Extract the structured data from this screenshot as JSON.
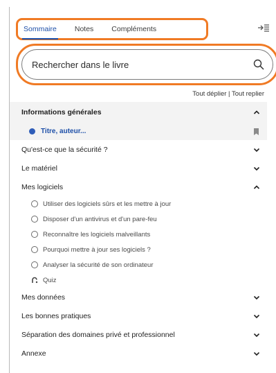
{
  "tabs": [
    "Sommaire",
    "Notes",
    "Compléments"
  ],
  "search": {
    "placeholder": "Rechercher dans le livre"
  },
  "tools": {
    "expand_all": "Tout déplier",
    "separator": " | ",
    "collapse_all": "Tout replier"
  },
  "toc": {
    "current_section": "Informations générales",
    "current_item": "Titre, auteur...",
    "sections": [
      "Qu'est-ce que la sécurité ?",
      "Le matériel",
      "Mes logiciels",
      "Mes données",
      "Les bonnes pratiques",
      "Séparation des domaines privé et professionnel",
      "Annexe"
    ],
    "software_items": [
      "Utiliser des logiciels sûrs et les mettre à jour",
      "Disposer d'un antivirus et d'un pare-feu",
      "Reconnaître les logiciels malveillants",
      "Pourquoi mettre à jour ses logiciels ?",
      "Analyser la sécurité de son ordinateur"
    ],
    "quiz": "Quiz"
  },
  "colors": {
    "accent_outline": "#f07a24",
    "active_blue": "#1d4fa8",
    "row_highlight": "#f3f3f3"
  },
  "icons": [
    "collapse-panel-icon",
    "search-icon",
    "chevron-up-icon",
    "chevron-down-icon",
    "bookmark-icon",
    "quiz-icon"
  ]
}
